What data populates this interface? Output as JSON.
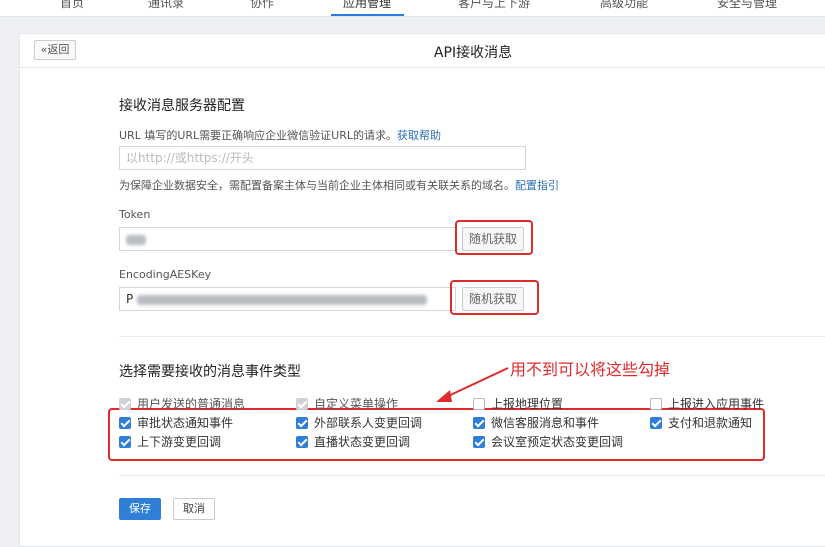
{
  "nav": {
    "tabs": [
      "首页",
      "通讯录",
      "协作",
      "应用管理",
      "客户与上下游",
      "高级功能",
      "安全与管理"
    ],
    "active_tab": "应用管理"
  },
  "header": {
    "back_label": "返回",
    "title": "API接收消息"
  },
  "server_config": {
    "section_title": "接收消息服务器配置",
    "url_hint_prefix": "URL  填写的URL需要正确响应企业微信验证URL的请求。",
    "url_hint_link": "获取帮助",
    "url_placeholder": "以http://或https://开头",
    "domain_hint": "为保障企业数据安全，需配置备案主体与当前企业主体相同或有关联关系的域名。",
    "domain_hint_link": "配置指引",
    "token_label": "Token",
    "token_random_label": "随机获取",
    "aeskey_label": "EncodingAESKey",
    "aeskey_value_prefix": "P",
    "aeskey_random_label": "随机获取"
  },
  "events": {
    "section_title": "选择需要接收的消息事件类型",
    "annotation": "用不到可以将这些勾掉",
    "items": [
      {
        "label": "用户发送的普通消息",
        "state": "disabled-checked"
      },
      {
        "label": "自定义菜单操作",
        "state": "disabled-checked"
      },
      {
        "label": "上报地理位置",
        "state": "unchecked"
      },
      {
        "label": "上报进入应用事件",
        "state": "unchecked"
      },
      {
        "label": "审批状态通知事件",
        "state": "checked"
      },
      {
        "label": "外部联系人变更回调",
        "state": "checked"
      },
      {
        "label": "微信客服消息和事件",
        "state": "checked"
      },
      {
        "label": "支付和退款通知",
        "state": "checked"
      },
      {
        "label": "上下游变更回调",
        "state": "checked"
      },
      {
        "label": "直播状态变更回调",
        "state": "checked"
      },
      {
        "label": "会议室预定状态变更回调",
        "state": "checked"
      }
    ]
  },
  "footer": {
    "save_label": "保存",
    "cancel_label": "取消"
  },
  "colors": {
    "accent": "#2f7fd8",
    "annotation_red": "#e02b2b"
  }
}
